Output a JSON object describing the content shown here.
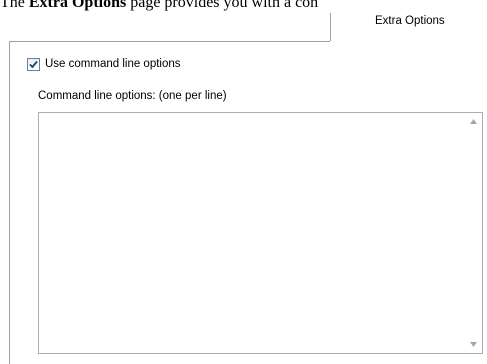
{
  "doc_text": {
    "prefix": "The ",
    "bold": "Extra Options",
    "suffix": " page provides you with a con"
  },
  "tab": {
    "label": "Extra Options"
  },
  "options": {
    "use_command_line_label": "Use command line options",
    "use_command_line_checked": true,
    "command_line_field_label": "Command line options:  (one per line)",
    "command_line_value": ""
  },
  "icons": {
    "checkbox_check": "check-icon",
    "scroll_up": "scroll-up-arrow-icon",
    "scroll_down": "scroll-down-arrow-icon"
  },
  "colors": {
    "check": "#1f3f7a",
    "border": "#a0a0a0",
    "arrow": "#a6a6a6"
  }
}
